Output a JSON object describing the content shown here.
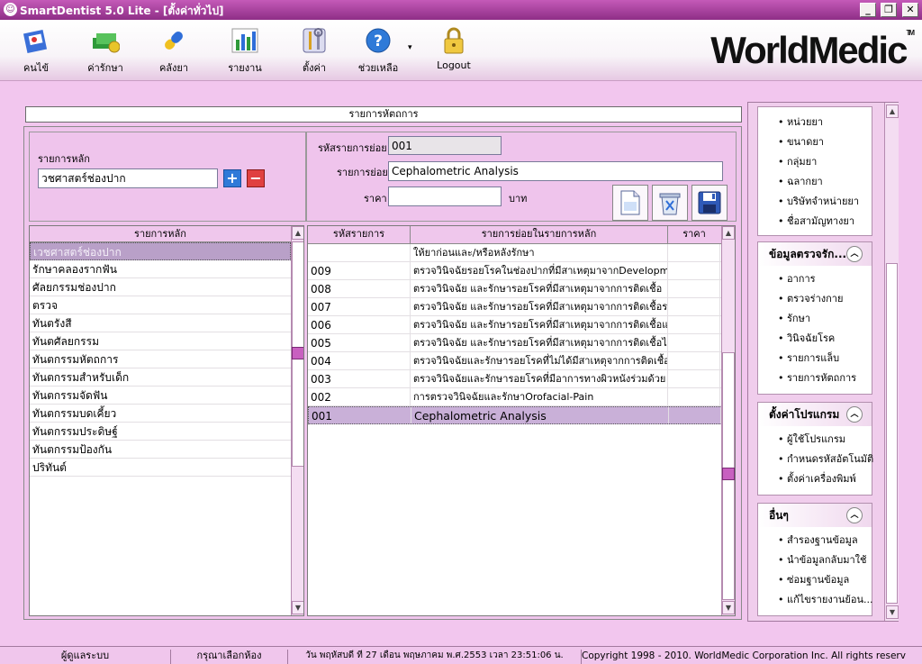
{
  "window": {
    "title": "SmartDentist 5.0 Lite - [ตั้งค่าทั่วไป]"
  },
  "toolbar": {
    "items": [
      "คนไข้",
      "ค่ารักษา",
      "คลังยา",
      "รายงาน",
      "ตั้งค่า",
      "ช่วยเหลือ",
      "Logout"
    ]
  },
  "brand": "WorldMedic",
  "section_title": "รายการหัตถการ",
  "form": {
    "main_label": "รายการหลัก",
    "main_value": "วชศาสตร์ช่องปาก",
    "code_label": "รหัสรายการย่อย",
    "code_value": "001",
    "name_label": "รายการย่อย",
    "name_value": "Cephalometric Analysis",
    "price_label": "ราคา",
    "price_value": "",
    "baht": "บาท"
  },
  "left_grid": {
    "header": "รายการหลัก",
    "rows": [
      "เวชศาสตร์ช่องปาก",
      "รักษาคลองรากฟัน",
      "ศัลยกรรมช่องปาก",
      "ตรวจ",
      "ทันตรังสี",
      "ทันตศัลยกรรม",
      "ทันตกรรมหัตถการ",
      "ทันตกรรมสำหรับเด็ก",
      "ทันตกรรมจัดฟัน",
      "ทันตกรรมบดเคี้ยว",
      "ทันตกรรมประดิษฐ์",
      "ทันตกรรมป้องกัน",
      "ปริทันต์"
    ]
  },
  "right_grid": {
    "headers": [
      "รหัสรายการ",
      "รายการย่อยในรายการหลัก",
      "ราคา"
    ],
    "rows": [
      {
        "code": "",
        "name": "ให้ยาก่อนและ/หรือหลังรักษา",
        "price": ""
      },
      {
        "code": "009",
        "name": "ตรวจวินิจฉัยรอยโรคในช่องปากที่มีสาเหตุมาจากDevelopme",
        "price": ""
      },
      {
        "code": "008",
        "name": "ตรวจวินิจฉัย และรักษารอยโรคที่มีสาเหตุมาจากการติดเชื้อ",
        "price": ""
      },
      {
        "code": "007",
        "name": "ตรวจวินิจฉัย และรักษารอยโรคที่มีสาเหตุมาจากการติดเชื้อรา",
        "price": ""
      },
      {
        "code": "006",
        "name": "ตรวจวินิจฉัย และรักษารอยโรคที่มีสาเหตุมาจากการติดเชื้อแบคฯ",
        "price": ""
      },
      {
        "code": "005",
        "name": "ตรวจวินิจฉัย และรักษารอยโรคที่มีสาเหตุมาจากการติดเชื้อไวรัส",
        "price": ""
      },
      {
        "code": "004",
        "name": "ตรวจวินิจฉัยและรักษารอยโรคที่ไม่ได้มีสาเหตุจากการติดเชื้อเช่า",
        "price": ""
      },
      {
        "code": "003",
        "name": "ตรวจวินิจฉัยและรักษารอยโรคที่มีอาการทางผิวหนังร่วมด้วย",
        "price": ""
      },
      {
        "code": "002",
        "name": "การตรวจวินิจฉัยและรักษาOrofacial-Pain",
        "price": ""
      },
      {
        "code": "001",
        "name": "Cephalometric Analysis",
        "price": ""
      }
    ]
  },
  "sidebar": {
    "group0_items": [
      "หน่วยยา",
      "ขนาดยา",
      "กลุ่มยา",
      "ฉลากยา",
      "บริษัทจำหน่ายยา",
      "ชื่อสามัญทางยา"
    ],
    "group1": {
      "title": "ข้อมูลตรวจรัก...",
      "items": [
        "อาการ",
        "ตรวจร่างกาย",
        "รักษา",
        "วินิจฉัยโรค",
        "รายการแล็บ",
        "รายการหัตถการ"
      ]
    },
    "group2": {
      "title": "ตั้งค่าโปรแกรม",
      "items": [
        "ผู้ใช้โปรแกรม",
        "กำหนดรหัสอัตโนมัติ",
        "ตั้งค่าเครื่องพิมพ์"
      ]
    },
    "group3": {
      "title": "อื่นๆ",
      "items": [
        "สำรองฐานข้อมูล",
        "นำข้อมูลกลับมาใช้",
        "ซ่อมฐานข้อมูล",
        "แก้ไขรายงานย้อน..."
      ]
    }
  },
  "status": {
    "user": "ผู้ดูแลระบบ",
    "room": "กรุณาเลือกห้อง",
    "datetime": "วัน พฤหัสบดี ที่ 27 เดือน พฤษภาคม พ.ศ.2553 เวลา 23:51:06 น.",
    "copyright": "Copyright 1998 - 2010. WorldMedic Corporation Inc. All rights reserved."
  }
}
